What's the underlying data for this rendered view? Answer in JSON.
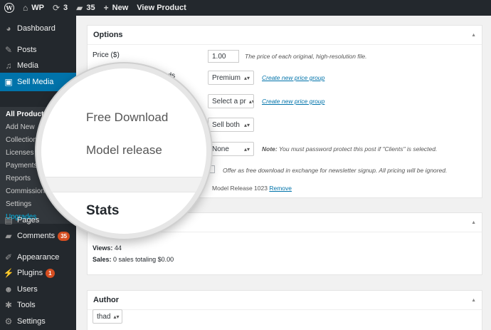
{
  "admin_bar": {
    "logo_icon": "wordpress-logo-icon",
    "site_name": "WP",
    "updates_count": "3",
    "comments_count": "35",
    "new_label": "New",
    "view_label": "View Product"
  },
  "sidebar": {
    "dashboard": "Dashboard",
    "posts": "Posts",
    "media": "Media",
    "sell_media": "Sell Media",
    "submenu": [
      "All Products",
      "Add New",
      "Collections",
      "Licenses",
      "Payments",
      "Reports",
      "Commissions",
      "Settings",
      "Upgrades"
    ],
    "pages": "Pages",
    "comments": "Comments",
    "comments_badge": "35",
    "appearance": "Appearance",
    "plugins": "Plugins",
    "plugins_badge": "1",
    "users": "Users",
    "tools": "Tools",
    "settings": "Settings"
  },
  "options": {
    "title": "Options",
    "price_label": "Price ($)",
    "price_value": "1.00",
    "price_desc": "The price of each original, high-resolution file.",
    "price_group_label": "Price group for downloads",
    "price_group_value": "Premium",
    "price_group_link": "Create new price group",
    "price_group2_value": "Select a pr",
    "price_group2_link": "Create new price group",
    "sell_value": "Sell both",
    "release_value": "None",
    "release_note_bold": "Note:",
    "release_note": "You must password protect this post if \"Clients\" is selected.",
    "free_download_text": "Offer as free download in exchange for newsletter signup. All pricing will be ignored.",
    "model_release_text": "Model Release 1023",
    "remove_link": "Remove"
  },
  "magnifier": {
    "free_download": "Free Download",
    "model_release": "Model release",
    "stats": "Stats"
  },
  "stats": {
    "views_label": "Views:",
    "views_value": "44",
    "sales_label": "Sales:",
    "sales_value": "0 sales totaling $0.00"
  },
  "author": {
    "title": "Author",
    "value": "thad"
  }
}
